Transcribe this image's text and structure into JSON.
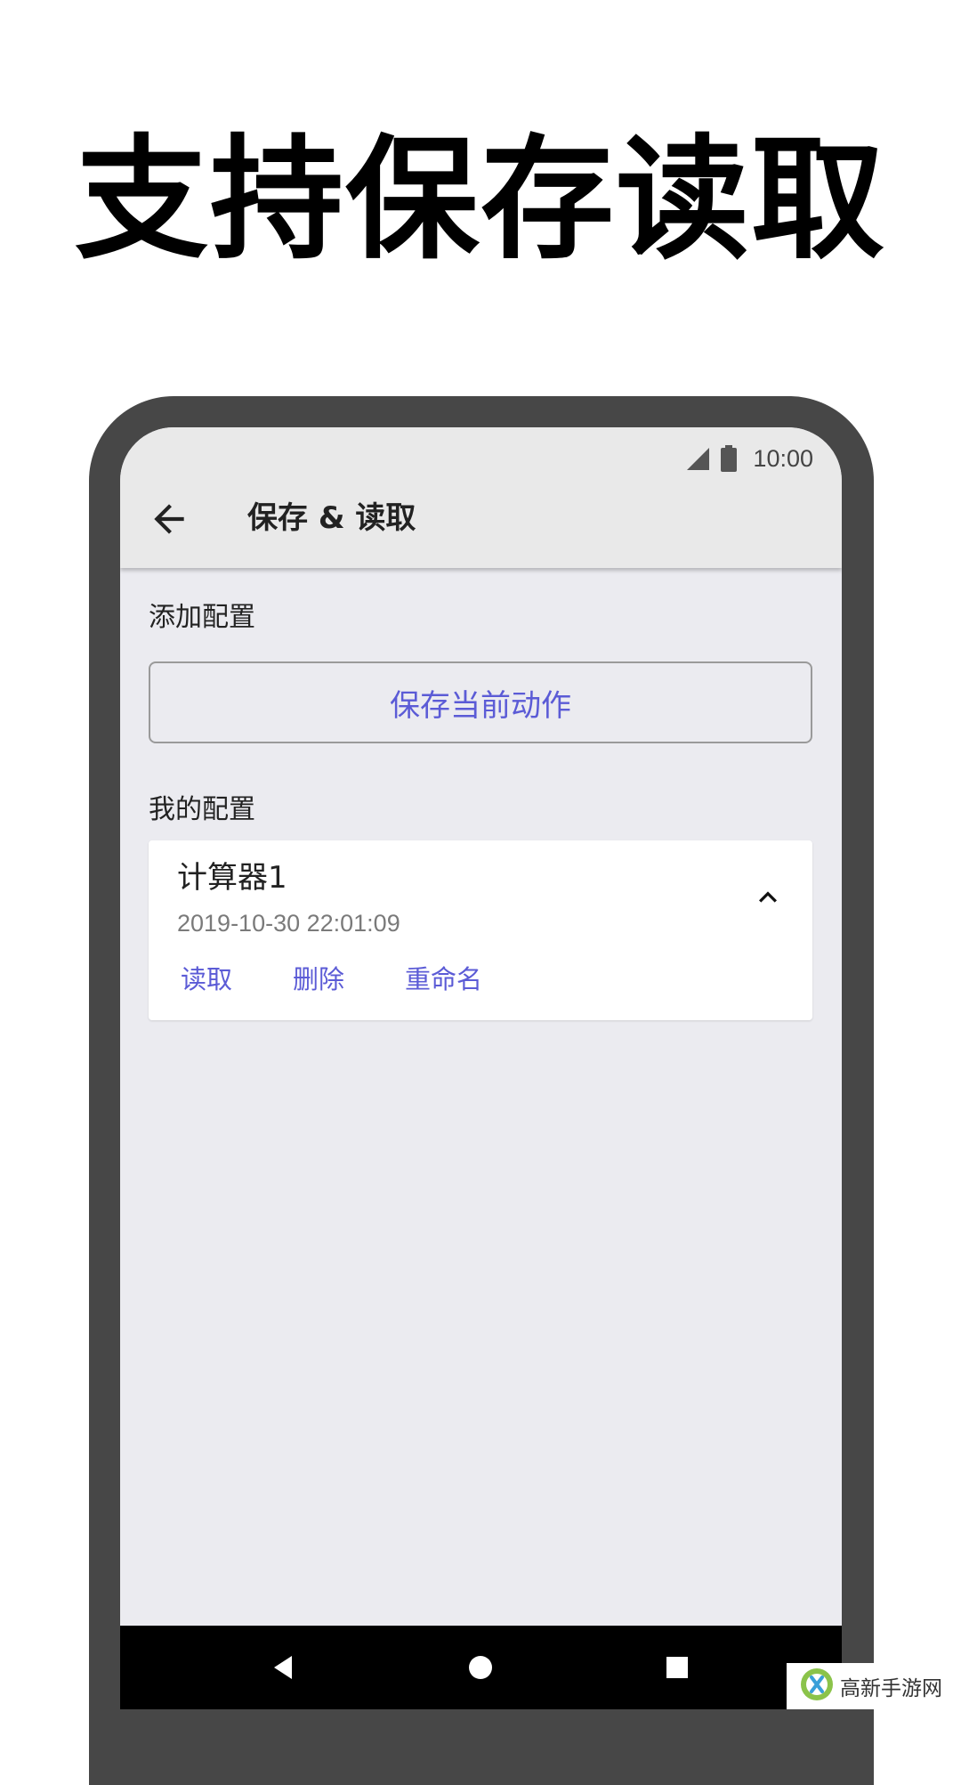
{
  "headline": "支持保存读取",
  "status_bar": {
    "time": "10:00",
    "icons": [
      "signal-icon",
      "battery-icon"
    ]
  },
  "app_bar": {
    "back_icon": "arrow-left-icon",
    "title": "保存 & 读取"
  },
  "add_section": {
    "label": "添加配置",
    "save_button_label": "保存当前动作"
  },
  "my_section": {
    "label": "我的配置",
    "items": [
      {
        "name": "计算器1",
        "date": "2019-10-30 22:01:09",
        "expanded_icon": "chevron-up-icon",
        "actions": [
          "读取",
          "删除",
          "重命名"
        ]
      }
    ]
  },
  "nav_bar": {
    "icons": [
      "back-triangle-icon",
      "home-circle-icon",
      "recents-square-icon"
    ]
  },
  "watermark": {
    "text": "高新手游网"
  },
  "colors": {
    "accent": "#5b5bd6",
    "frame": "#474747",
    "screen_bg": "#ebebf0",
    "appbar_bg": "#e9e9e9"
  }
}
